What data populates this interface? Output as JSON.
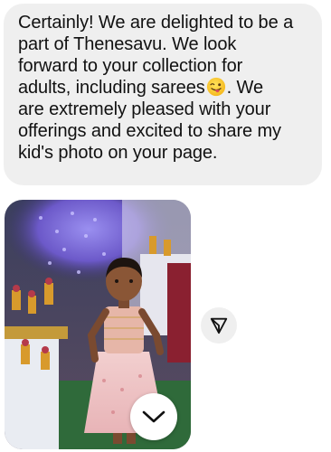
{
  "message": {
    "lines": [
      "Certainly! We are delighted to be a",
      "part of Thenesavu. We look",
      "forward to your collection for",
      "adults, including sarees",
      ". We",
      "are extremely pleased with your",
      "offerings and excited to share my",
      "kid's photo on your page."
    ],
    "emoji_icon": "winking-face-with-tongue-icon"
  },
  "attachment": {
    "type": "photo",
    "expand_icon": "chevron-down-icon"
  },
  "actions": {
    "share_icon": "paper-plane-icon"
  },
  "colors": {
    "bubble_background": "#efefef",
    "text": "#111111"
  }
}
